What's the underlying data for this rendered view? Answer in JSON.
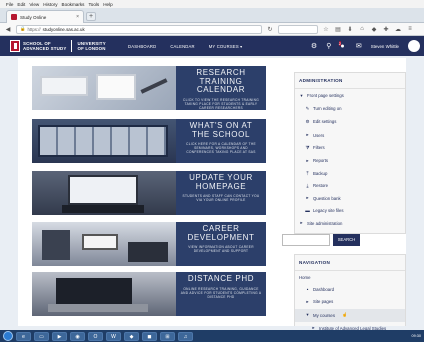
{
  "browser": {
    "menu": [
      "File",
      "Edit",
      "View",
      "History",
      "Bookmarks",
      "Tools",
      "Help"
    ],
    "tab_title": "Study Online",
    "tab_close": "×",
    "new_tab": "+",
    "url_prefix": "https://",
    "url_domain": "studyonline.sas.ac.uk"
  },
  "site": {
    "logo_line1": "SCHOOL OF",
    "logo_line2": "ADVANCED STUDY",
    "logo_line3": "UNIVERSITY",
    "logo_line4": "OF LONDON",
    "nav": [
      "DASHBOARD",
      "CALENDAR",
      "MY COURSES ▾"
    ],
    "notification_count": "2",
    "username": "Steven Whittle"
  },
  "banners": [
    {
      "title": "RESEARCH TRAINING CALENDAR",
      "subtitle": "CLICK TO VIEW THE RESEARCH TRAINING TAKING PLACE FOR STUDENTS & EARLY CAREER RESEARCHERS"
    },
    {
      "title": "WHAT'S ON AT THE SCHOOL",
      "subtitle": "CLICK HERE FOR A CALENDAR OF THE SEMINARS, WORKSHOPS AND CONFERENCES TAKING PLACE AT SAS"
    },
    {
      "title": "UPDATE YOUR HOMEPAGE",
      "subtitle": "STUDENTS AND STAFF CAN CONTACT YOU VIA YOUR ONLINE PROFILE"
    },
    {
      "title": "CAREER DEVELOPMENT",
      "subtitle": "VIEW INFORMATION ABOUT CAREER DEVELOPMENT AND SUPPORT"
    },
    {
      "title": "DISTANCE PHD",
      "subtitle": "ONLINE RESEARCH TRAINING, GUIDANCE AND ADVICE FOR STUDENTS COMPLETING A DISTANCE PHD"
    }
  ],
  "administration": {
    "heading": "ADMINISTRATION",
    "front_page": "Front page settings",
    "items": [
      "Turn editing on",
      "Edit settings",
      "Users",
      "Filters",
      "Reports",
      "Backup",
      "Restore",
      "Question bank",
      "Legacy site files"
    ],
    "site_admin": "Site administration",
    "search_button": "SEARCH"
  },
  "navigation": {
    "heading": "NAVIGATION",
    "home": "Home",
    "items": [
      "Dashboard",
      "Site pages",
      "My courses",
      "Institute of Advanced Legal Studies"
    ]
  },
  "taskbar": {
    "clock": "09:30"
  }
}
